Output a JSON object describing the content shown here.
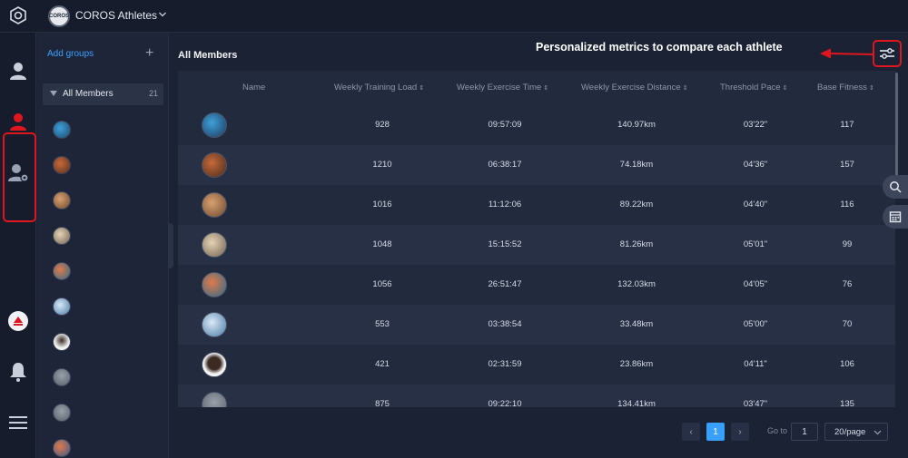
{
  "header": {
    "team_name": "COROS Athletes",
    "badge_text": "COROS"
  },
  "groups": {
    "add_label": "Add groups",
    "add_icon": "plus-icon",
    "all_members_label": "All Members",
    "all_members_count": "21"
  },
  "main": {
    "title": "All Members",
    "annotation": "Personalized metrics to compare each athlete",
    "columns": [
      "Name",
      "Weekly Training Load",
      "Weekly Exercise Time",
      "Weekly Exercise Distance",
      "Threshold Pace",
      "Base Fitness"
    ],
    "rows": [
      {
        "load": "928",
        "time": "09:57:09",
        "distance": "140.97km",
        "pace": "03'22\"",
        "fitness": "117"
      },
      {
        "load": "1210",
        "time": "06:38:17",
        "distance": "74.18km",
        "pace": "04'36\"",
        "fitness": "157"
      },
      {
        "load": "1016",
        "time": "11:12:06",
        "distance": "89.22km",
        "pace": "04'40\"",
        "fitness": "116"
      },
      {
        "load": "1048",
        "time": "15:15:52",
        "distance": "81.26km",
        "pace": "05'01\"",
        "fitness": "99"
      },
      {
        "load": "1056",
        "time": "26:51:47",
        "distance": "132.03km",
        "pace": "04'05\"",
        "fitness": "76"
      },
      {
        "load": "553",
        "time": "03:38:54",
        "distance": "33.48km",
        "pace": "05'00\"",
        "fitness": "70"
      },
      {
        "load": "421",
        "time": "02:31:59",
        "distance": "23.86km",
        "pace": "04'11\"",
        "fitness": "106"
      },
      {
        "load": "875",
        "time": "09:22:10",
        "distance": "134.41km",
        "pace": "03'47\"",
        "fitness": "135"
      }
    ]
  },
  "pagination": {
    "prev": "‹",
    "current": "1",
    "next": "›",
    "goto_label": "Go to",
    "goto_value": "1",
    "page_size": "20/page"
  },
  "colors": {
    "highlight": "#e0161f",
    "accent": "#3aa0ff",
    "background": "#1b2234"
  }
}
